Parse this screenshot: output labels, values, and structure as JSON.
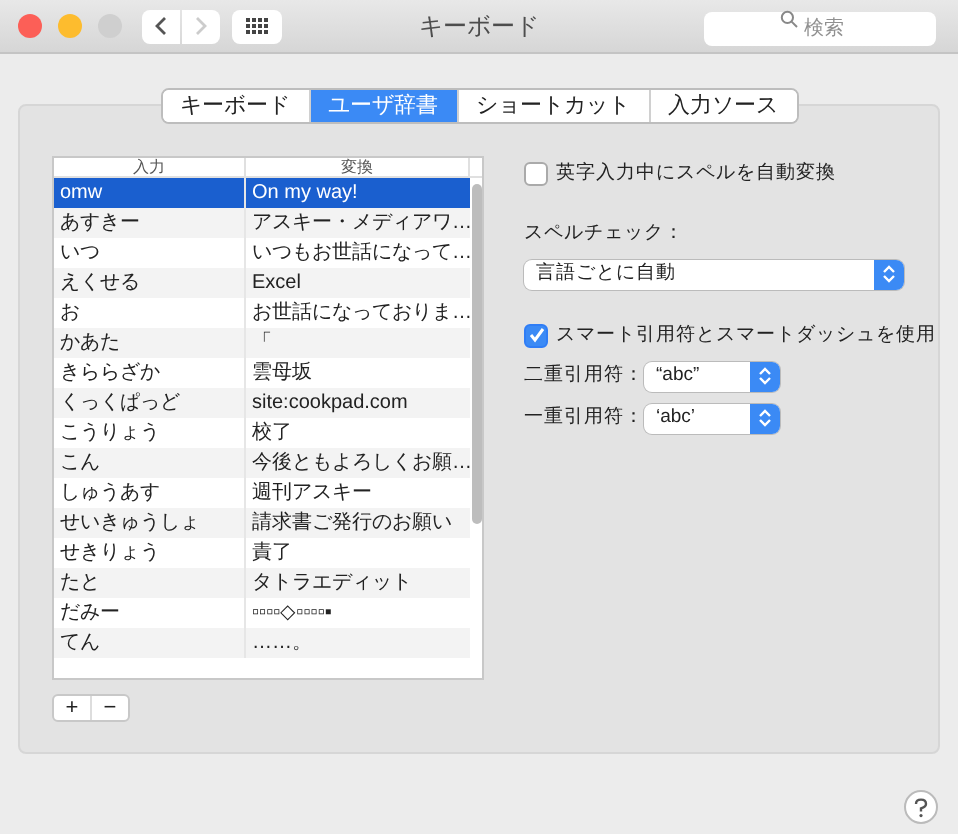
{
  "window": {
    "title": "キーボード",
    "search_placeholder": "検索"
  },
  "tabs": [
    {
      "label": "キーボード",
      "selected": false
    },
    {
      "label": "ユーザ辞書",
      "selected": true
    },
    {
      "label": "ショートカット",
      "selected": false
    },
    {
      "label": "入力ソース",
      "selected": false
    }
  ],
  "table": {
    "columns": [
      "入力",
      "変換"
    ],
    "rows": [
      {
        "input": "omw",
        "output": "On my way!",
        "selected": true
      },
      {
        "input": "あすきー",
        "output": "アスキー・メディアワ…",
        "selected": false
      },
      {
        "input": "いつ",
        "output": "いつもお世話になって…",
        "selected": false
      },
      {
        "input": "えくせる",
        "output": "Excel",
        "selected": false
      },
      {
        "input": "お",
        "output": "お世話になっておりま…",
        "selected": false
      },
      {
        "input": "かあた",
        "output": "「",
        "selected": false
      },
      {
        "input": "きららざか",
        "output": "雲母坂",
        "selected": false
      },
      {
        "input": "くっくぱっど",
        "output": "site:cookpad.com",
        "selected": false
      },
      {
        "input": "こうりょう",
        "output": "校了",
        "selected": false
      },
      {
        "input": "こん",
        "output": "今後ともよろしくお願…",
        "selected": false
      },
      {
        "input": "しゅうあす",
        "output": "週刊アスキー",
        "selected": false
      },
      {
        "input": "せいきゅうしょ",
        "output": "請求書ご発行のお願い",
        "selected": false
      },
      {
        "input": "せきりょう",
        "output": "責了",
        "selected": false
      },
      {
        "input": "たと",
        "output": "タトラエディット",
        "selected": false
      },
      {
        "input": "だみー",
        "output": "▫▫▫▫◇▫▫▫▫▪",
        "selected": false
      },
      {
        "input": "てん",
        "output": "……。",
        "selected": false
      }
    ]
  },
  "buttons": [
    "+",
    "−"
  ],
  "auto_spell": {
    "label": "英字入力中にスペルを自動変換",
    "checked": false
  },
  "spell_check": {
    "label": "スペルチェック：",
    "value": "言語ごとに自動"
  },
  "smart_quotes": {
    "label": "スマート引用符とスマートダッシュを使用",
    "checked": true
  },
  "double_quotes": {
    "label": "二重引用符：",
    "value": "“abc”"
  },
  "single_quotes": {
    "label": "一重引用符：",
    "value": "‘abc’"
  }
}
